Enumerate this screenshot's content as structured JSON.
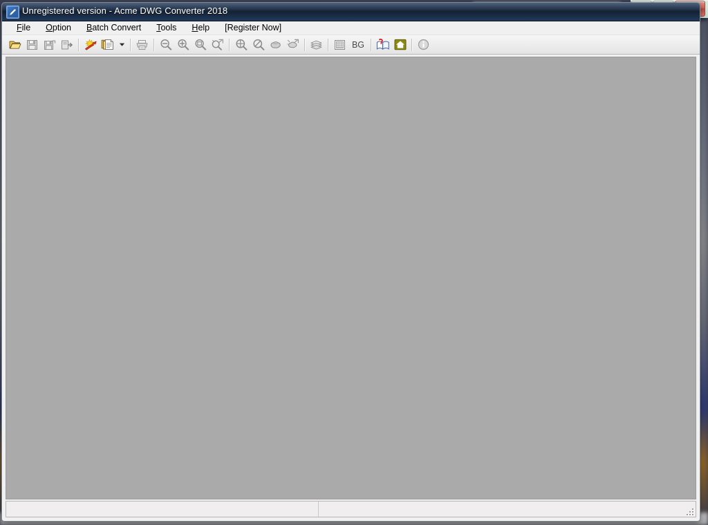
{
  "window": {
    "title": "Unregistered version - Acme DWG Converter 2018",
    "app_icon": "dwg-converter-icon",
    "controls": {
      "minimize": "Minimize",
      "maximize": "Maximize",
      "close": "Close"
    }
  },
  "menubar": {
    "items": [
      {
        "label": "File",
        "accel": "F"
      },
      {
        "label": "Option",
        "accel": "O"
      },
      {
        "label": "Batch Convert",
        "accel": "B"
      },
      {
        "label": "Tools",
        "accel": "T"
      },
      {
        "label": "Help",
        "accel": "H"
      },
      {
        "label": "[Register Now]",
        "accel": ""
      }
    ]
  },
  "toolbar": {
    "buttons": [
      {
        "name": "open-file-button",
        "tip": "Open",
        "enabled": true
      },
      {
        "name": "save-button",
        "tip": "Save",
        "enabled": false
      },
      {
        "name": "save-as-button",
        "tip": "Save As",
        "enabled": false
      },
      {
        "name": "export-button",
        "tip": "Export",
        "enabled": false
      },
      {
        "name": "convert-button",
        "tip": "Convert",
        "enabled": true
      },
      {
        "name": "batch-convert-button",
        "tip": "Batch Convert",
        "enabled": true
      },
      {
        "name": "batch-convert-dropdown",
        "tip": "Batch Convert Options",
        "enabled": true
      },
      {
        "name": "print-button",
        "tip": "Print",
        "enabled": false
      },
      {
        "name": "zoom-out-button",
        "tip": "Zoom Out",
        "enabled": false
      },
      {
        "name": "zoom-in-button",
        "tip": "Zoom In",
        "enabled": false
      },
      {
        "name": "zoom-window-button",
        "tip": "Zoom Window",
        "enabled": false
      },
      {
        "name": "zoom-realtime-button",
        "tip": "Zoom Realtime",
        "enabled": false
      },
      {
        "name": "zoom-extents-button",
        "tip": "Zoom Extents",
        "enabled": false
      },
      {
        "name": "zoom-previous-button",
        "tip": "Zoom Previous",
        "enabled": false
      },
      {
        "name": "pan-button",
        "tip": "Pan",
        "enabled": false
      },
      {
        "name": "pan-realtime-button",
        "tip": "Pan Realtime",
        "enabled": false
      },
      {
        "name": "layers-button",
        "tip": "Layers",
        "enabled": false
      },
      {
        "name": "display-grid-button",
        "tip": "Display",
        "enabled": false
      },
      {
        "name": "background-color-button",
        "label": "BG",
        "tip": "Background Color",
        "enabled": true
      },
      {
        "name": "help-book-button",
        "tip": "Help",
        "enabled": true
      },
      {
        "name": "home-button",
        "tip": "Home Page",
        "enabled": true
      },
      {
        "name": "about-info-button",
        "tip": "About",
        "enabled": false
      }
    ],
    "bg_label": "BG"
  },
  "client": {
    "background_color": "#aaaaaa",
    "content": ""
  },
  "statusbar": {
    "message": "",
    "right_pane": "",
    "resize_grip": "resize-grip-icon"
  },
  "background_browser": {
    "tabs": [
      {
        "title": "",
        "active": false
      },
      {
        "title": "",
        "active": false
      },
      {
        "title": "",
        "active": true
      }
    ]
  },
  "colors": {
    "title_bar_start": "#1f3556",
    "title_bar_end": "#22395b",
    "client_gray": "#aaaaaa",
    "toolbar_face": "#ececec",
    "close_button_red": "#c04a40",
    "accent_blue": "#2f63ad",
    "home_icon_olive": "#8a8a12"
  }
}
